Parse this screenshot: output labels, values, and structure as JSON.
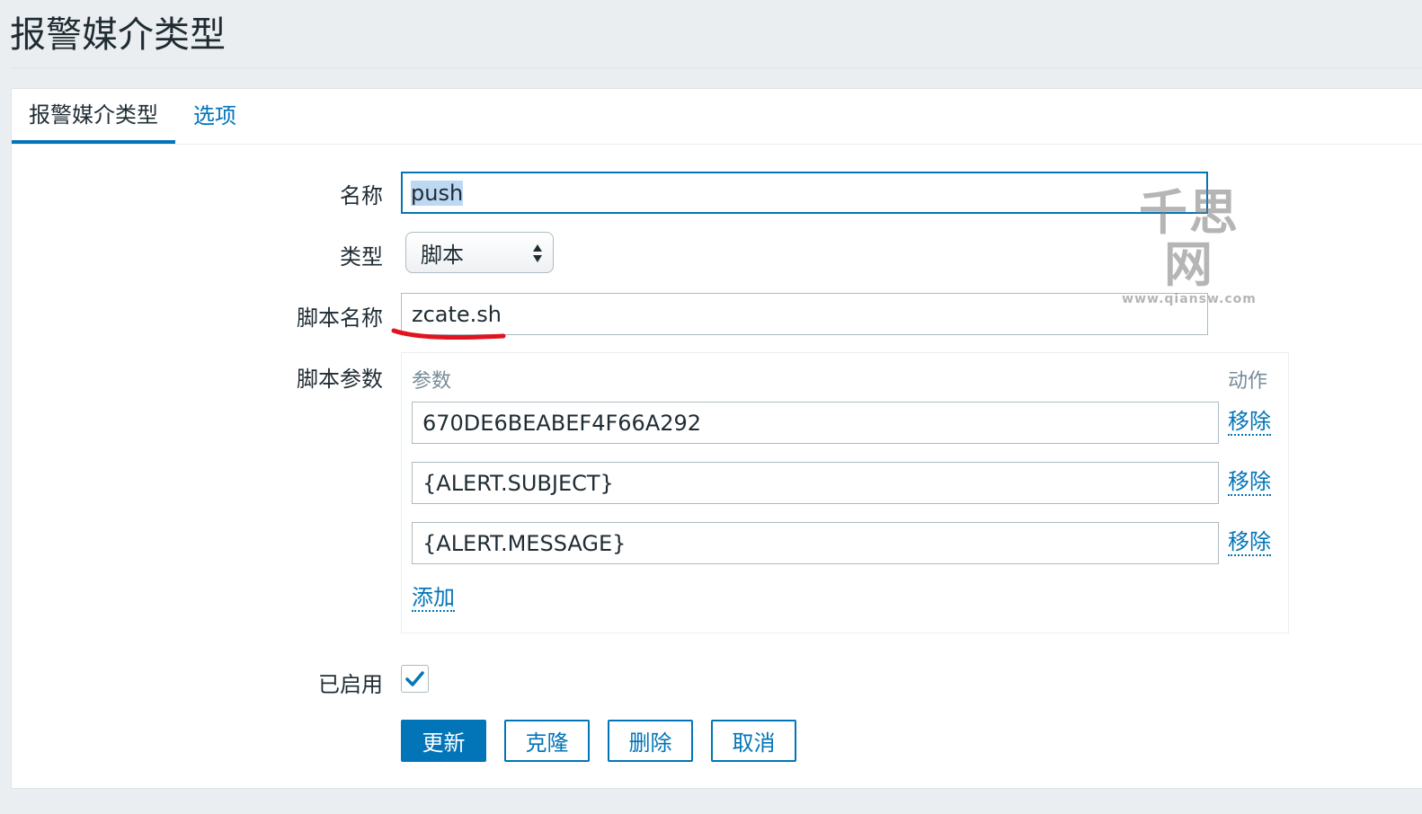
{
  "page": {
    "title": "报警媒介类型"
  },
  "tabs": [
    {
      "label": "报警媒介类型",
      "active": true
    },
    {
      "label": "选项",
      "active": false
    }
  ],
  "form": {
    "name": {
      "label": "名称",
      "value": "push"
    },
    "type": {
      "label": "类型",
      "value": "脚本"
    },
    "script_name": {
      "label": "脚本名称",
      "value": "zcate.sh"
    },
    "script_params": {
      "label": "脚本参数",
      "col_param": "参数",
      "col_action": "动作",
      "rows": [
        {
          "value": "670DE6BEABEF4F66A292",
          "action": "移除"
        },
        {
          "value": "{ALERT.SUBJECT}",
          "action": "移除"
        },
        {
          "value": "{ALERT.MESSAGE}",
          "action": "移除"
        }
      ],
      "add_label": "添加"
    },
    "enabled": {
      "label": "已启用",
      "checked": true
    }
  },
  "buttons": {
    "update": "更新",
    "clone": "克隆",
    "delete": "删除",
    "cancel": "取消"
  },
  "watermark": {
    "main": "千思网",
    "sub": "www.qiansw.com"
  },
  "colors": {
    "accent": "#0275b8",
    "annotation": "#e0141e",
    "background": "#ebeef0"
  }
}
